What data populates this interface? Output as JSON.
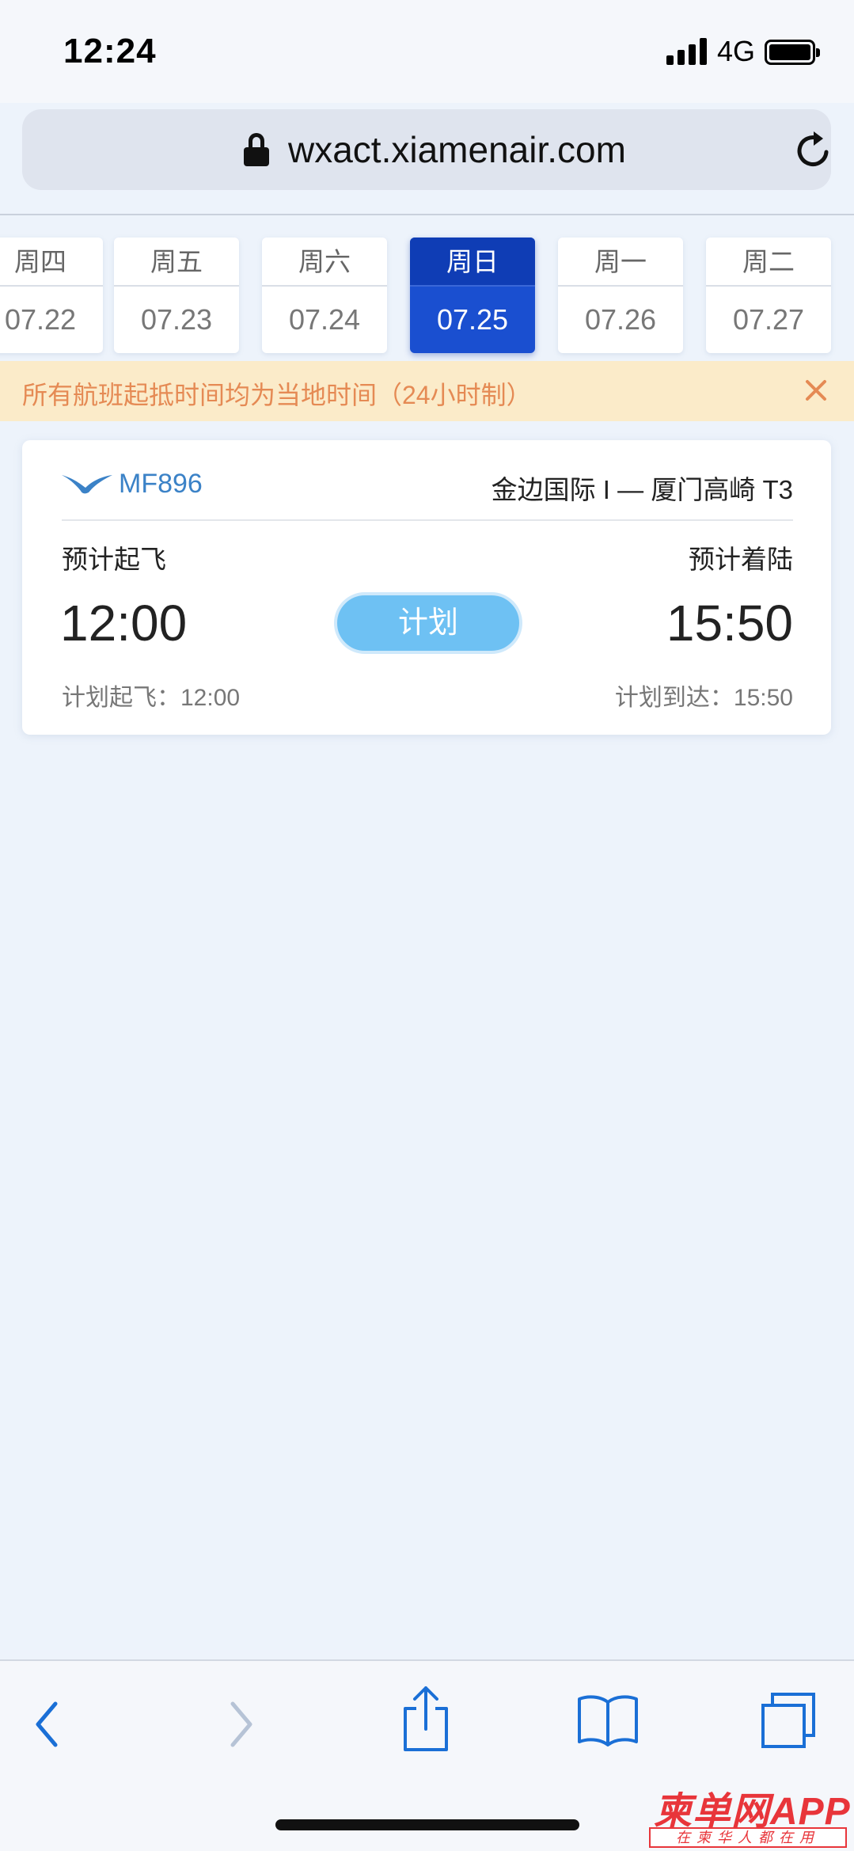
{
  "status_bar": {
    "time": "12:24",
    "network": "4G"
  },
  "browser": {
    "url": "wxact.xiamenair.com"
  },
  "date_tabs": [
    {
      "weekday": "周四",
      "date": "07.22"
    },
    {
      "weekday": "周五",
      "date": "07.23"
    },
    {
      "weekday": "周六",
      "date": "07.24"
    },
    {
      "weekday": "周日",
      "date": "07.25",
      "selected": true
    },
    {
      "weekday": "周一",
      "date": "07.26"
    },
    {
      "weekday": "周二",
      "date": "07.27"
    }
  ],
  "notice": {
    "text": "所有航班起抵时间均为当地时间（24小时制）"
  },
  "flight": {
    "number": "MF896",
    "route": "金边国际 I — 厦门高崎 T3",
    "departure_label": "预计起飞",
    "arrival_label": "预计着陆",
    "departure_time": "12:00",
    "arrival_time": "15:50",
    "status": "计划",
    "scheduled_departure": "计划起飞：12:00",
    "scheduled_arrival": "计划到达：15:50"
  },
  "toolbar": {
    "icons": [
      "back-icon",
      "forward-icon",
      "share-icon",
      "bookmarks-icon",
      "tabs-icon"
    ]
  },
  "watermark": {
    "main": "柬单网APP",
    "sub": "在柬华人都在用"
  },
  "colors": {
    "accent": "#1a4fd0",
    "status_pill": "#6ec1f3",
    "notice_bg": "#fbebc9",
    "notice_text": "#e58a54",
    "link_blue": "#3b82c7"
  }
}
